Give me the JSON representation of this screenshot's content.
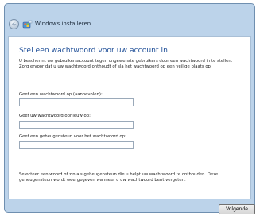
{
  "window": {
    "title": "Windows installeren"
  },
  "page": {
    "heading": "Stel een wachtwoord voor uw account in",
    "intro": "U beschermt uw gebruikersaccount tegen ongewenste gebruikers door een wachtwoord in te stellen. Zorg ervoor dat u uw wachtwoord onthoudt of sla het wachtwoord op een veilige plaats op.",
    "password_label": "Geef een wachtwoord op (aanbevolen):",
    "password_value": "",
    "confirm_label": "Geef uw wachtwoord opnieuw op:",
    "confirm_value": "",
    "hint_label": "Geef een geheugensteun voor het wachtwoord op:",
    "hint_value": "",
    "hint_explanation": "Selecteer een woord of zin als geheugensteun die u helpt uw wachtwoord te onthouden. Deze geheugensteun wordt weergegeven wanneer u uw wachtwoord bent vergeten."
  },
  "buttons": {
    "next_label": "Volgende"
  },
  "icons": {
    "back": "back-arrow-icon",
    "app": "windows-setup-icon"
  },
  "colors": {
    "heading": "#1e4e97",
    "frame": "#bcd3ea"
  }
}
